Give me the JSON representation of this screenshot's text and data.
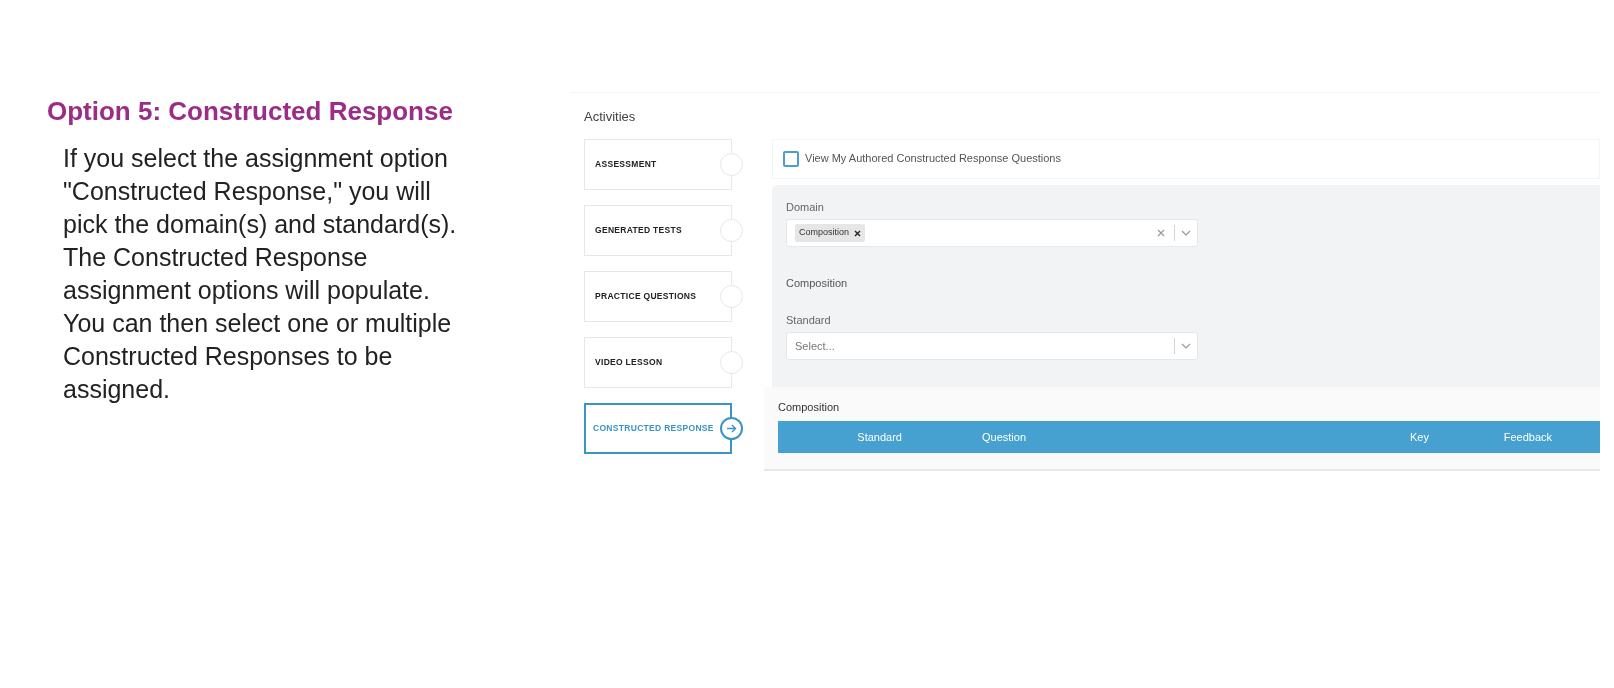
{
  "heading": "Option 5: Constructed Response",
  "paragraph": "If you select the assignment option \"Constructed Response,\" you will pick the domain(s) and standard(s). The Constructed Response assignment options will populate. You can then select one or multiple Constructed Responses to be assigned.",
  "screenshot": {
    "section_title": "Activities",
    "activities": [
      {
        "label": "ASSESSMENT",
        "selected": false
      },
      {
        "label": "GENERATED TESTS",
        "selected": false
      },
      {
        "label": "PRACTICE QUESTIONS",
        "selected": false
      },
      {
        "label": "VIDEO LESSON",
        "selected": false
      },
      {
        "label": "CONSTRUCTED RESPONSE",
        "selected": true
      }
    ],
    "authored_filter": {
      "label": "View My Authored Constructed Response Questions",
      "checked": false
    },
    "domain": {
      "label": "Domain",
      "tags": [
        "Composition"
      ]
    },
    "domain_heading": "Composition",
    "standard": {
      "label": "Standard",
      "placeholder": "Select..."
    },
    "table": {
      "title": "Composition",
      "columns": [
        "Standard",
        "Question",
        "Key",
        "Feedback"
      ]
    }
  }
}
